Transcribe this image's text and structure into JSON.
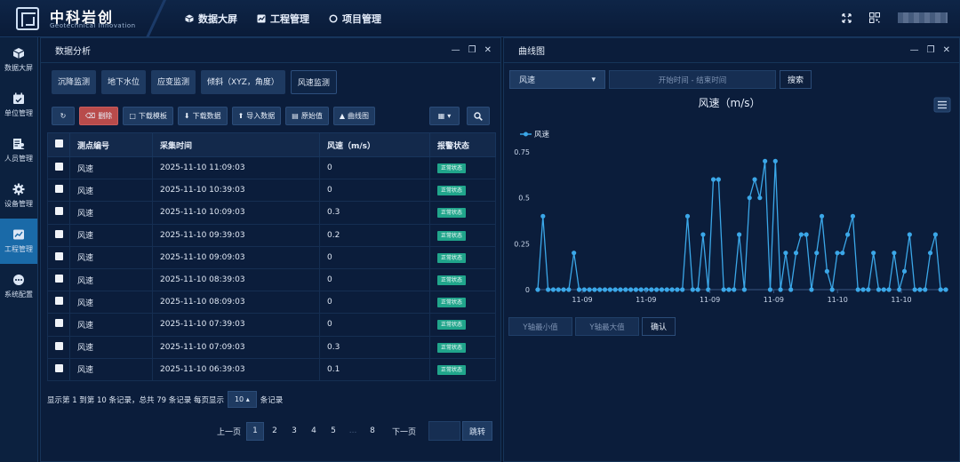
{
  "brand": {
    "name": "中科岩创",
    "tagline": "Geotechnical Innovation"
  },
  "nav": [
    {
      "label": "数据大屏",
      "icon": "cube-icon"
    },
    {
      "label": "工程管理",
      "icon": "chart-card-icon"
    },
    {
      "label": "项目管理",
      "icon": "circle-icon"
    }
  ],
  "sidebar": [
    {
      "label": "数据大屏",
      "icon": "cube-icon"
    },
    {
      "label": "单位管理",
      "icon": "calendar-check-icon"
    },
    {
      "label": "人员管理",
      "icon": "user-list-icon"
    },
    {
      "label": "设备管理",
      "icon": "gear-icon"
    },
    {
      "label": "工程管理",
      "icon": "chart-card-icon"
    },
    {
      "label": "系统配置",
      "icon": "dots-icon"
    }
  ],
  "left_panel": {
    "title": "数据分析",
    "tabs": [
      "沉降监测",
      "地下水位",
      "应变监测",
      "倾斜（XYZ，角度）",
      "风速监测"
    ],
    "active_tab": 4,
    "toolbar": [
      "删除",
      "下载模板",
      "下载数据",
      "导入数据",
      "原始值",
      "曲线图"
    ],
    "table": {
      "headers": [
        "测点编号",
        "采集时间",
        "风速（m/s）",
        "报警状态"
      ],
      "rows": [
        [
          "风速",
          "2025-11-10 11:09:03",
          "0",
          "正常状态"
        ],
        [
          "风速",
          "2025-11-10 10:39:03",
          "0",
          "正常状态"
        ],
        [
          "风速",
          "2025-11-10 10:09:03",
          "0.3",
          "正常状态"
        ],
        [
          "风速",
          "2025-11-10 09:39:03",
          "0.2",
          "正常状态"
        ],
        [
          "风速",
          "2025-11-10 09:09:03",
          "0",
          "正常状态"
        ],
        [
          "风速",
          "2025-11-10 08:39:03",
          "0",
          "正常状态"
        ],
        [
          "风速",
          "2025-11-10 08:09:03",
          "0",
          "正常状态"
        ],
        [
          "风速",
          "2025-11-10 07:39:03",
          "0",
          "正常状态"
        ],
        [
          "风速",
          "2025-11-10 07:09:03",
          "0.3",
          "正常状态"
        ],
        [
          "风速",
          "2025-11-10 06:39:03",
          "0.1",
          "正常状态"
        ]
      ]
    },
    "pager": {
      "info_prefix": "显示第 1 到第 10 条记录，总共 79 条记录 每页显示",
      "page_size": "10",
      "info_suffix": "条记录",
      "prev": "上一页",
      "pages": [
        "1",
        "2",
        "3",
        "4",
        "5",
        "...",
        "8"
      ],
      "current": "1",
      "next": "下一页",
      "go": "跳转"
    }
  },
  "right_panel": {
    "title": "曲线图",
    "select_value": "风速",
    "date_placeholder": "开始时间 - 结束时间",
    "search_label": "搜索",
    "ymin_placeholder": "Y轴最小值",
    "ymax_placeholder": "Y轴最大值",
    "confirm_label": "确认"
  },
  "chart_data": {
    "type": "line",
    "title": "风速（m/s）",
    "legend": [
      "风速"
    ],
    "ylim": [
      0,
      0.75
    ],
    "yticks": [
      0,
      0.25,
      0.5,
      0.75
    ],
    "xtick_labels": [
      "11-09",
      "11-09",
      "11-09",
      "11-09",
      "11-10",
      "11-10"
    ],
    "color": "#3ba7e8",
    "series": [
      {
        "name": "风速",
        "values": [
          0,
          0.4,
          0,
          0,
          0,
          0,
          0,
          0.2,
          0,
          0,
          0,
          0,
          0,
          0,
          0,
          0,
          0,
          0,
          0,
          0,
          0,
          0,
          0,
          0,
          0,
          0,
          0,
          0,
          0,
          0.4,
          0,
          0,
          0.3,
          0,
          0.6,
          0.6,
          0,
          0,
          0,
          0.3,
          0,
          0.5,
          0.6,
          0.5,
          0.7,
          0,
          0.7,
          0,
          0.2,
          0,
          0.2,
          0.3,
          0.3,
          0,
          0.2,
          0.4,
          0.1,
          0,
          0.2,
          0.2,
          0.3,
          0.4,
          0,
          0,
          0,
          0.2,
          0,
          0,
          0,
          0.2,
          0,
          0.1,
          0.3,
          0,
          0,
          0,
          0.2,
          0.3,
          0,
          0
        ]
      }
    ]
  }
}
